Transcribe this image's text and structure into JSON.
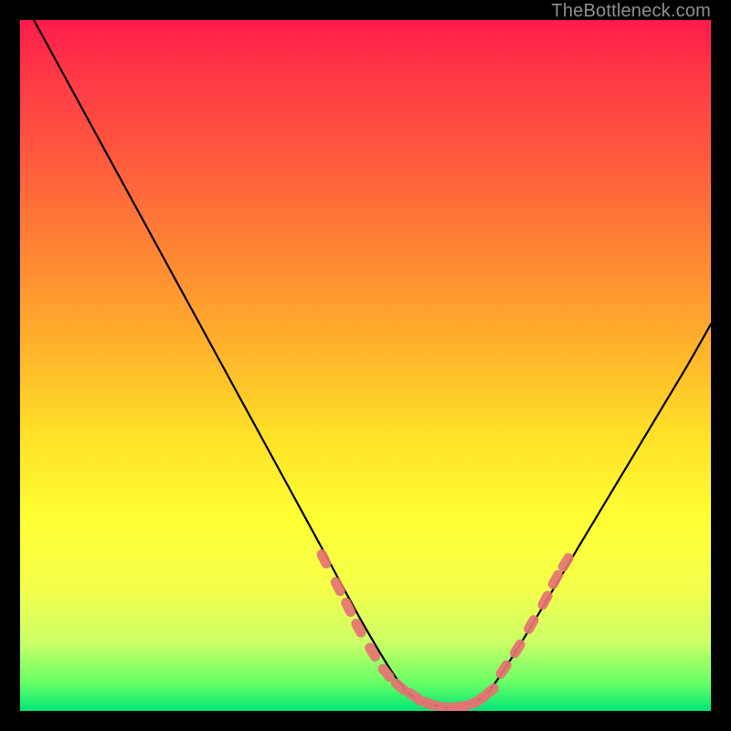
{
  "watermark": "TheBottleneck.com",
  "chart_data": {
    "type": "line",
    "title": "",
    "xlabel": "",
    "ylabel": "",
    "xlim": [
      0,
      100
    ],
    "ylim": [
      0,
      100
    ],
    "grid": false,
    "series": [
      {
        "name": "bottleneck-curve",
        "x": [
          2,
          8,
          14,
          20,
          26,
          32,
          38,
          44,
          50,
          55,
          58,
          60,
          62,
          64,
          66,
          68,
          72,
          78,
          84,
          90,
          96,
          100
        ],
        "y": [
          100,
          89,
          78,
          67,
          56,
          45,
          34,
          23,
          12,
          4,
          1.5,
          0.8,
          0.5,
          0.7,
          1.4,
          3,
          9,
          19,
          29,
          39,
          49,
          56
        ],
        "color": "#000000"
      }
    ],
    "markers": [
      {
        "name": "highlight-dots-left",
        "color": "#e57373",
        "points": [
          [
            44,
            22
          ],
          [
            46,
            18
          ],
          [
            47.5,
            15
          ],
          [
            49,
            12
          ],
          [
            51,
            8.5
          ],
          [
            53,
            5.5
          ],
          [
            55,
            3.5
          ],
          [
            57,
            2.2
          ]
        ]
      },
      {
        "name": "highlight-dots-bottom",
        "color": "#e57373",
        "points": [
          [
            58.5,
            1.3
          ],
          [
            60,
            0.8
          ],
          [
            62,
            0.5
          ],
          [
            63.5,
            0.6
          ],
          [
            65,
            0.9
          ],
          [
            66.5,
            1.6
          ],
          [
            68,
            2.8
          ]
        ]
      },
      {
        "name": "highlight-dots-right",
        "color": "#e57373",
        "points": [
          [
            70,
            6
          ],
          [
            72,
            9
          ],
          [
            74,
            12.5
          ],
          [
            76,
            16
          ],
          [
            77.5,
            19
          ],
          [
            79,
            21.5
          ]
        ]
      }
    ]
  }
}
